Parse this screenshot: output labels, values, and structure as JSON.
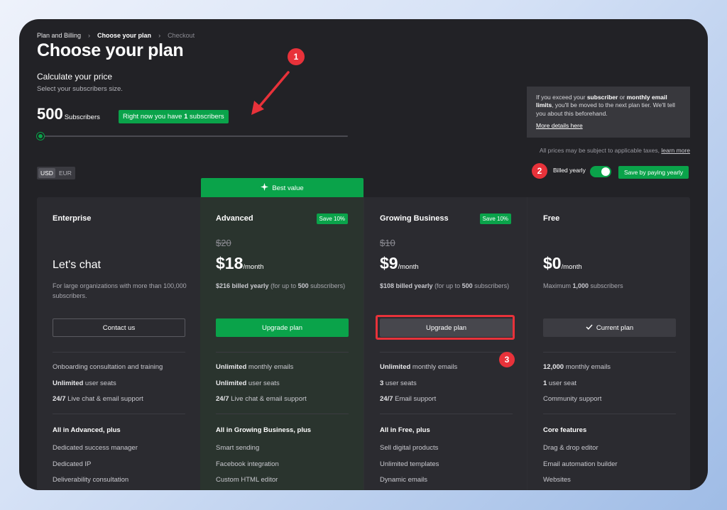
{
  "breadcrumb": {
    "item1": "Plan and Billing",
    "item2": "Choose your plan",
    "item3": "Checkout"
  },
  "page_title": "Choose your plan",
  "calculator": {
    "title": "Calculate your price",
    "subtitle": "Select your subscribers size.",
    "count": "500",
    "count_label": "Subscribers",
    "pill_pre": "Right now you have ",
    "pill_num": "1",
    "pill_post": " subscribers"
  },
  "info": {
    "t1": "If you exceed your ",
    "b1": "subscriber",
    "t2": " or ",
    "b2": "monthly email limits",
    "t3": ", you'll be moved to the next plan tier. We'll tell you about this beforehand.",
    "link": "More details here"
  },
  "tax": {
    "text": "All prices may be subject to applicable taxes, ",
    "link": "learn more"
  },
  "currency": {
    "on": "USD",
    "off": "EUR"
  },
  "billing": {
    "label": "Billed yearly",
    "save": "Save by paying yearly"
  },
  "best_value": "Best value",
  "annotations": {
    "a1": "1",
    "a2": "2",
    "a3": "3"
  },
  "plans": [
    {
      "name": "Enterprise",
      "headline": "Let's chat",
      "desc": "For large organizations with more than 100,000 subscribers.",
      "button": "Contact us",
      "f1": "Onboarding consultation and training",
      "f2b": "Unlimited",
      "f2": " user seats",
      "f3b": "24/7",
      "f3": " Live chat & email support",
      "head": "All in Advanced, plus",
      "e1": "Dedicated success manager",
      "e2": "Dedicated IP",
      "e3": "Deliverability consultation"
    },
    {
      "name": "Advanced",
      "save": "Save 10%",
      "old": "$20",
      "price": "$18",
      "per": "/month",
      "db": "$216 billed yearly",
      "d1": " (for up to ",
      "dn": "500",
      "d2": " subscribers)",
      "button": "Upgrade plan",
      "f1b": "Unlimited",
      "f1": " monthly emails",
      "f2b": "Unlimited",
      "f2": " user seats",
      "f3b": "24/7",
      "f3": " Live chat & email support",
      "head": "All in Growing Business, plus",
      "e1": "Smart sending",
      "e2": "Facebook integration",
      "e3": "Custom HTML editor"
    },
    {
      "name": "Growing Business",
      "save": "Save 10%",
      "old": "$10",
      "price": "$9",
      "per": "/month",
      "db": "$108 billed yearly",
      "d1": " (for up to ",
      "dn": "500",
      "d2": " subscribers)",
      "button": "Upgrade plan",
      "f1b": "Unlimited",
      "f1": " monthly emails",
      "f2b": "3",
      "f2": " user seats",
      "f3b": "24/7",
      "f3": " Email support",
      "head": "All in Free, plus",
      "e1": "Sell digital products",
      "e2": "Unlimited templates",
      "e3": "Dynamic emails"
    },
    {
      "name": "Free",
      "price": "$0",
      "per": "/month",
      "d1": "Maximum ",
      "dn": "1,000",
      "d2": " subscribers",
      "button": "Current plan",
      "f1b": "12,000",
      "f1": " monthly emails",
      "f2b": "1",
      "f2": " user seat",
      "f3": "Community support",
      "head": "Core features",
      "e1": "Drag & drop editor",
      "e2": "Email automation builder",
      "e3": "Websites"
    }
  ],
  "colors": {
    "accent": "#0aa34a",
    "annotation": "#e8323a",
    "background": "#222226"
  }
}
